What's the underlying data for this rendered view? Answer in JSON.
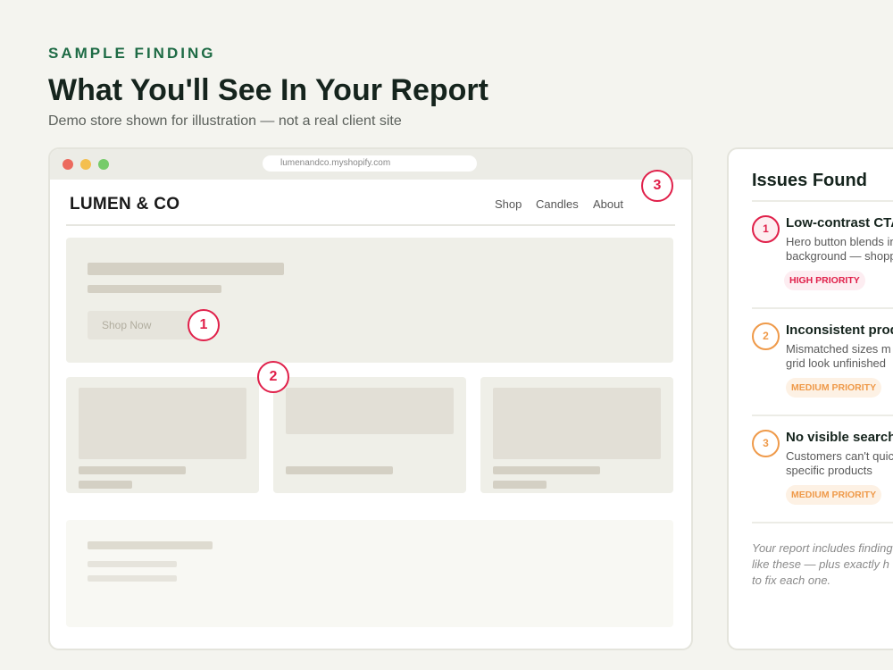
{
  "header": {
    "eyebrow": "SAMPLE FINDING",
    "title": "What You'll See In Your Report",
    "subtitle": "Demo store shown for illustration — not a real client site"
  },
  "browser": {
    "url": "lumenandco.myshopify.com",
    "store_name": "LUMEN & CO",
    "nav": [
      "Shop",
      "Candles",
      "About"
    ],
    "hero_button": "Shop Now",
    "markers": [
      "1",
      "2",
      "3"
    ]
  },
  "panel": {
    "title": "Issues Found",
    "issues": [
      {
        "number": "1",
        "title": "Low-contrast CTA",
        "desc_line1": "Hero button blends in",
        "desc_line2": "background — shopp",
        "priority": "HIGH PRIORITY"
      },
      {
        "number": "2",
        "title": "Inconsistent prod",
        "desc_line1": "Mismatched sizes m",
        "desc_line2": "grid look unfinished",
        "priority": "MEDIUM PRIORITY"
      },
      {
        "number": "3",
        "title": "No visible search",
        "desc_line1": "Customers can't quic",
        "desc_line2": "specific products",
        "priority": "MEDIUM PRIORITY"
      }
    ],
    "note_line1": "Your report includes finding",
    "note_line2": "like these — plus exactly h",
    "note_line3": "to fix each one."
  },
  "colors": {
    "accent_green": "#1e6b45",
    "high_priority": "#e0204a",
    "medium_priority": "#ef9a4a"
  }
}
